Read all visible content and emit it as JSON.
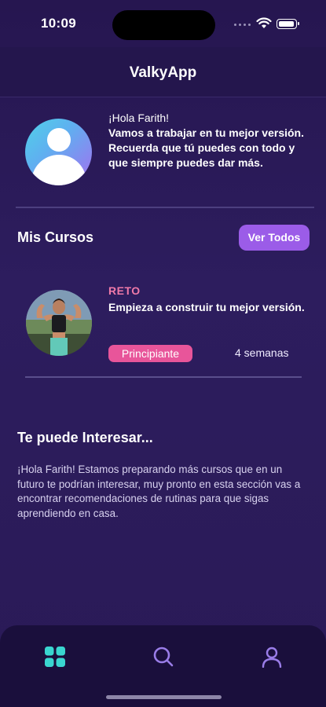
{
  "status_bar": {
    "time": "10:09"
  },
  "nav": {
    "title": "ValkyApp"
  },
  "greeting": {
    "hi": "¡Hola Farith!",
    "message": "Vamos a trabajar en tu mejor versión. Recuerda que tú puedes con todo y que siempre puedes dar más."
  },
  "courses": {
    "section_title": "Mis Cursos",
    "see_all_label": "Ver Todos",
    "items": [
      {
        "kicker": "RETO",
        "title": "Empieza a construir tu mejor versión.",
        "level": "Principiante",
        "duration": "4 semanas"
      }
    ]
  },
  "interest": {
    "section_title": "Te puede Interesar...",
    "body": "¡Hola Farith! Estamos preparando más cursos que en un futuro te podrían interesar, muy pronto en esta sección vas a encontrar recomendaciones de rutinas para que sigas aprendiendo en casa."
  },
  "tabs": [
    {
      "icon": "grid-icon",
      "active": true
    },
    {
      "icon": "search-icon",
      "active": false
    },
    {
      "icon": "profile-icon",
      "active": false
    }
  ],
  "colors": {
    "background": "#2b1b5c",
    "accent_button": "#9b5ce8",
    "badge": "#e8559a",
    "kicker": "#f07aa9",
    "tab_active": "#3ad6d0",
    "tab_inactive": "#9a7de8"
  }
}
